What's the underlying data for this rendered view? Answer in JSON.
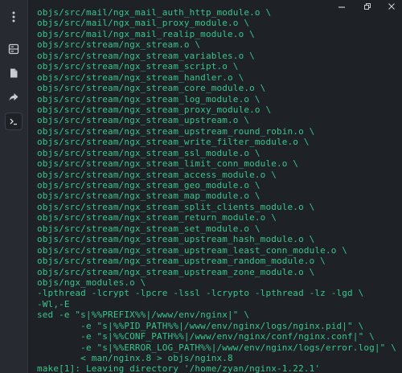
{
  "sidebar": {
    "menu_icon": "kebab-menu-icon",
    "items": [
      {
        "name": "server-icon",
        "active": false
      },
      {
        "name": "files-icon",
        "active": false
      },
      {
        "name": "forward-icon",
        "active": false
      },
      {
        "name": "terminal-icon",
        "active": true
      }
    ]
  },
  "window_controls": {
    "minimize": "minimize-icon",
    "maximize": "maximize-icon",
    "close": "close-icon"
  },
  "terminal": {
    "lines": [
      {
        "text": "objs/src/mail/ngx_mail_auth_http_module.o \\",
        "color": "green"
      },
      {
        "text": "objs/src/mail/ngx_mail_proxy_module.o \\",
        "color": "green"
      },
      {
        "text": "objs/src/mail/ngx_mail_realip_module.o \\",
        "color": "green"
      },
      {
        "text": "objs/src/stream/ngx_stream.o \\",
        "color": "green"
      },
      {
        "text": "objs/src/stream/ngx_stream_variables.o \\",
        "color": "green"
      },
      {
        "text": "objs/src/stream/ngx_stream_script.o \\",
        "color": "green"
      },
      {
        "text": "objs/src/stream/ngx_stream_handler.o \\",
        "color": "green"
      },
      {
        "text": "objs/src/stream/ngx_stream_core_module.o \\",
        "color": "green"
      },
      {
        "text": "objs/src/stream/ngx_stream_log_module.o \\",
        "color": "green"
      },
      {
        "text": "objs/src/stream/ngx_stream_proxy_module.o \\",
        "color": "green"
      },
      {
        "text": "objs/src/stream/ngx_stream_upstream.o \\",
        "color": "green"
      },
      {
        "text": "objs/src/stream/ngx_stream_upstream_round_robin.o \\",
        "color": "green"
      },
      {
        "text": "objs/src/stream/ngx_stream_write_filter_module.o \\",
        "color": "green"
      },
      {
        "text": "objs/src/stream/ngx_stream_ssl_module.o \\",
        "color": "green"
      },
      {
        "text": "objs/src/stream/ngx_stream_limit_conn_module.o \\",
        "color": "green"
      },
      {
        "text": "objs/src/stream/ngx_stream_access_module.o \\",
        "color": "green"
      },
      {
        "text": "objs/src/stream/ngx_stream_geo_module.o \\",
        "color": "green"
      },
      {
        "text": "objs/src/stream/ngx_stream_map_module.o \\",
        "color": "green"
      },
      {
        "text": "objs/src/stream/ngx_stream_split_clients_module.o \\",
        "color": "green"
      },
      {
        "text": "objs/src/stream/ngx_stream_return_module.o \\",
        "color": "green"
      },
      {
        "text": "objs/src/stream/ngx_stream_set_module.o \\",
        "color": "green"
      },
      {
        "text": "objs/src/stream/ngx_stream_upstream_hash_module.o \\",
        "color": "green"
      },
      {
        "text": "objs/src/stream/ngx_stream_upstream_least_conn_module.o \\",
        "color": "green"
      },
      {
        "text": "objs/src/stream/ngx_stream_upstream_random_module.o \\",
        "color": "green"
      },
      {
        "text": "objs/src/stream/ngx_stream_upstream_zone_module.o \\",
        "color": "green"
      },
      {
        "text": "objs/ngx_modules.o \\",
        "color": "green"
      },
      {
        "text": "-lpthread -lcrypt -lpcre -lssl -lcrypto -lpthread -lz -lgd \\",
        "color": "green"
      },
      {
        "text": "-Wl,-E",
        "color": "green"
      },
      {
        "text": "sed -e \"s|%%PREFIX%%|/www/env/nginx|\" \\",
        "color": "green"
      },
      {
        "text": "        -e \"s|%%PID_PATH%%|/www/env/nginx/logs/nginx.pid|\" \\",
        "color": "green"
      },
      {
        "text": "        -e \"s|%%CONF_PATH%%|/www/env/nginx/conf/nginx.conf|\" \\",
        "color": "green"
      },
      {
        "text": "        -e \"s|%%ERROR_LOG_PATH%%|/www/env/nginx/logs/error.log|\" \\",
        "color": "green"
      },
      {
        "text": "        < man/nginx.8 > objs/nginx.8",
        "color": "green"
      },
      {
        "text": "make[1]: Leaving directory '/home/zyan/nginx-1.22.1'",
        "color": "green"
      }
    ]
  },
  "colors": {
    "background": "#1e2227",
    "sidebar": "#272b31",
    "terminal_green": "#38c58a",
    "icon": "#c9ccd1"
  }
}
